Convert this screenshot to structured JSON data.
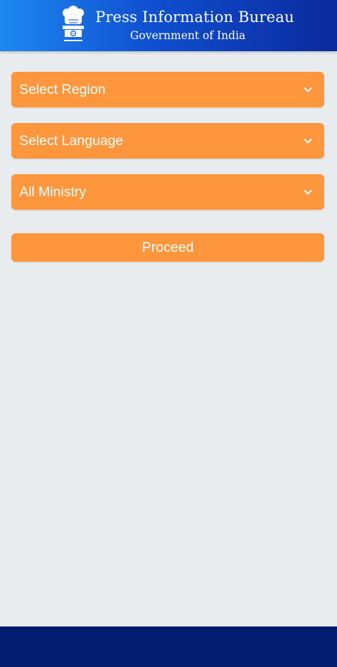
{
  "header": {
    "title": "Press Information Bureau",
    "subtitle": "Government of India",
    "emblem_icon": "national-emblem-icon"
  },
  "form": {
    "region_label": "Select Region",
    "language_label": "Select Language",
    "ministry_label": "All Ministry",
    "dropdown_icon": "chevron-down-icon",
    "proceed_label": "Proceed"
  },
  "colors": {
    "accent": "#fd963d",
    "header_start": "#1e88f0",
    "header_end": "#0b2a9c",
    "bottom_bar": "#041c70",
    "background": "#e8ecef"
  }
}
